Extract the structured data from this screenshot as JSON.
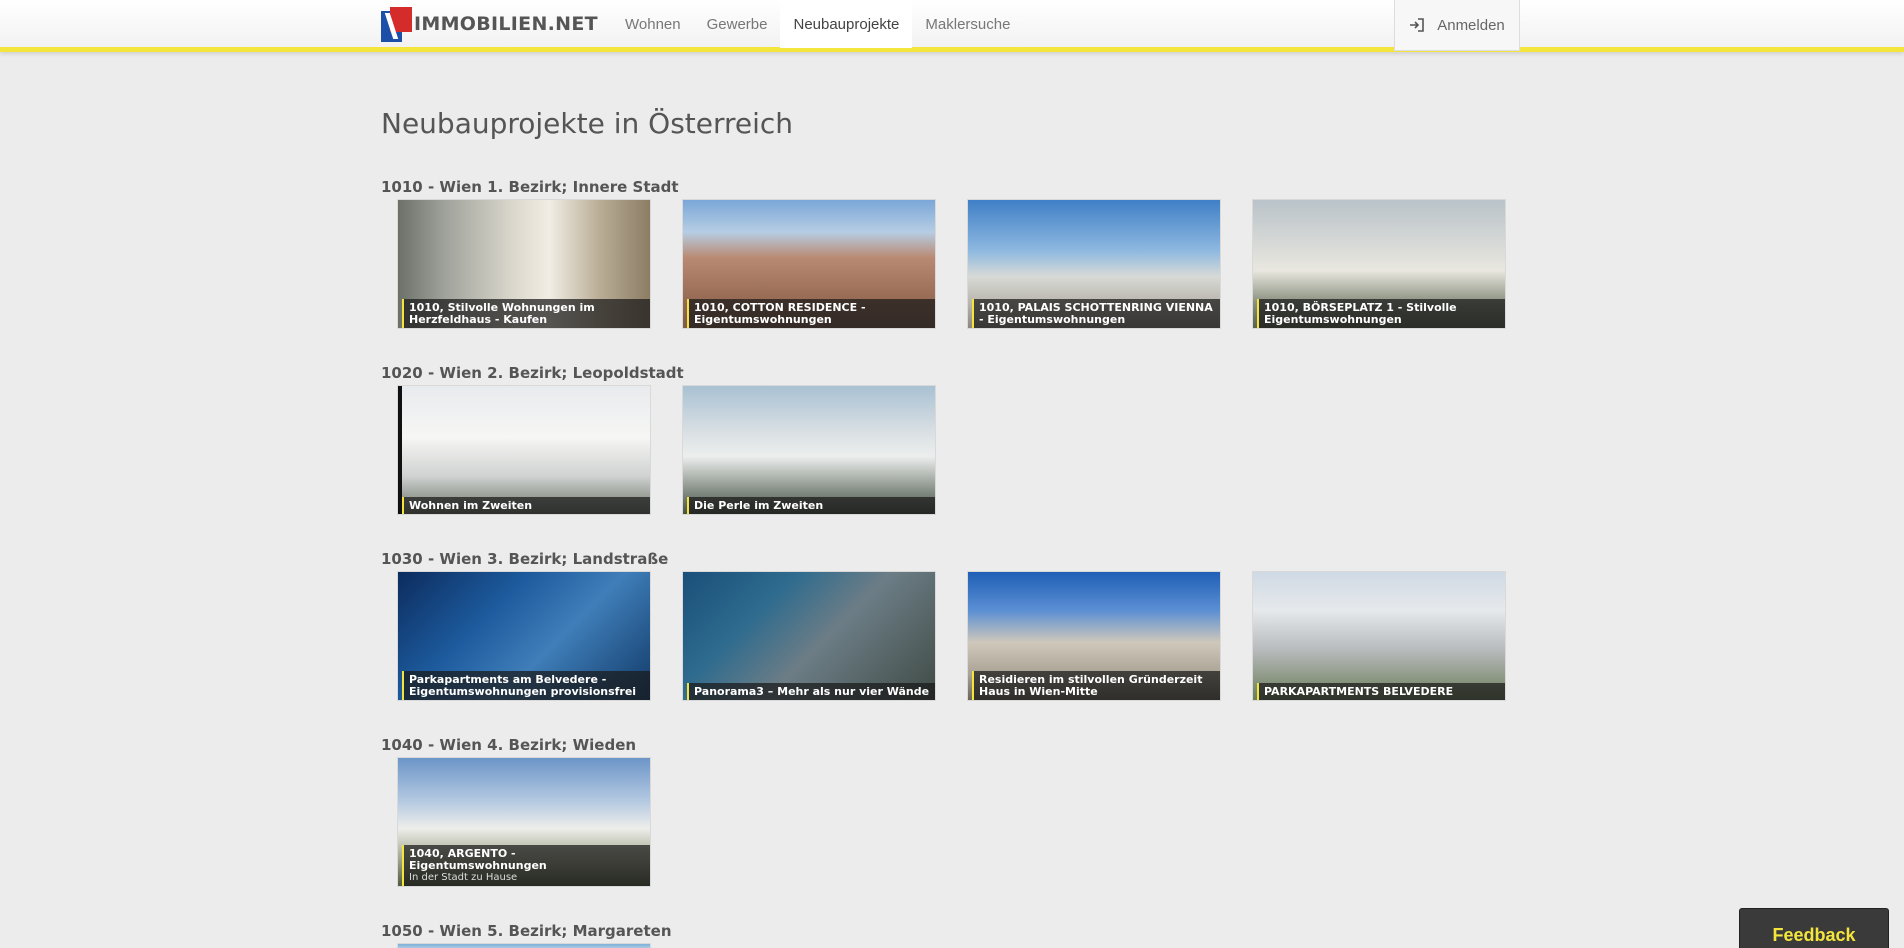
{
  "brand": {
    "name": "IMMOBILIEN.NET"
  },
  "nav": {
    "items": [
      {
        "label": "Wohnen"
      },
      {
        "label": "Gewerbe"
      },
      {
        "label": "Neubauprojekte"
      },
      {
        "label": "Maklersuche"
      }
    ],
    "active": "Neubauprojekte",
    "login_label": "Anmelden"
  },
  "page": {
    "title": "Neubauprojekte in Österreich"
  },
  "districts": [
    {
      "title": "1010 - Wien 1. Bezirk; Innere Stadt",
      "projects": [
        {
          "title": "1010, Stilvolle Wohnungen im Herzfeldhaus - Kaufen"
        },
        {
          "title": "1010, COTTON RESIDENCE - Eigentumswohnungen"
        },
        {
          "title": "1010, PALAIS SCHOTTENRING VIENNA - Eigentumswohnungen"
        },
        {
          "title": "1010, BÖRSEPLATZ 1 - Stilvolle Eigentumswohnungen"
        }
      ]
    },
    {
      "title": "1020 - Wien 2. Bezirk; Leopoldstadt",
      "projects": [
        {
          "title": "Wohnen im Zweiten"
        },
        {
          "title": "Die Perle im Zweiten"
        }
      ]
    },
    {
      "title": "1030 - Wien 3. Bezirk; Landstraße",
      "projects": [
        {
          "title": "Parkapartments am Belvedere - Eigentumswohnungen provisionsfrei"
        },
        {
          "title": "Panorama3 – Mehr als nur vier Wände"
        },
        {
          "title": "Residieren im stilvollen Gründerzeit Haus in Wien-Mitte"
        },
        {
          "title": "PARKAPARTMENTS BELVEDERE"
        }
      ]
    },
    {
      "title": "1040 - Wien 4. Bezirk; Wieden",
      "projects": [
        {
          "title": "1040, ARGENTO - Eigentumswohnungen",
          "subtitle": "In der Stadt zu Hause"
        }
      ]
    },
    {
      "title": "1050 - Wien 5. Bezirk; Margareten",
      "projects": []
    }
  ],
  "feedback": {
    "label": "Feedback"
  },
  "colors": {
    "accent": "#f4e53c",
    "background": "#ececec",
    "text": "#555555"
  }
}
